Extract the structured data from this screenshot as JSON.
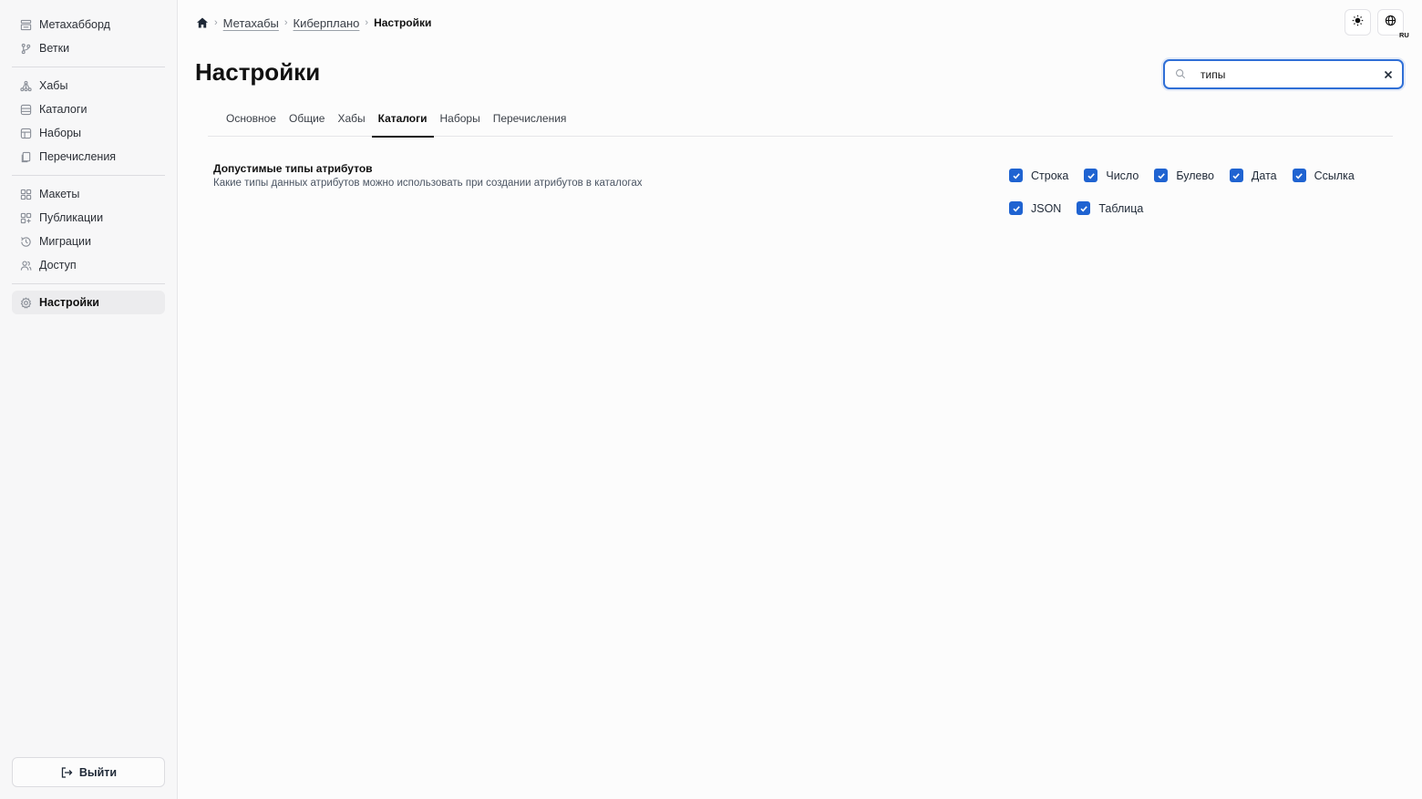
{
  "sidebar": {
    "groups": [
      [
        {
          "label": "Метахабборд",
          "icon": "dashboard-icon"
        },
        {
          "label": "Ветки",
          "icon": "branch-icon"
        }
      ],
      [
        {
          "label": "Хабы",
          "icon": "hub-icon"
        },
        {
          "label": "Каталоги",
          "icon": "database-icon"
        },
        {
          "label": "Наборы",
          "icon": "set-icon"
        },
        {
          "label": "Перечисления",
          "icon": "enum-icon"
        }
      ],
      [
        {
          "label": "Макеты",
          "icon": "layout-icon"
        },
        {
          "label": "Публикации",
          "icon": "publish-icon"
        },
        {
          "label": "Миграции",
          "icon": "history-icon"
        },
        {
          "label": "Доступ",
          "icon": "users-icon"
        }
      ],
      [
        {
          "label": "Настройки",
          "icon": "gear-icon",
          "active": true
        }
      ]
    ],
    "logout_label": "Выйти"
  },
  "breadcrumb": {
    "items": [
      "Метахабы",
      "Киберплано"
    ],
    "current": "Настройки"
  },
  "header": {
    "title": "Настройки",
    "lang": "RU"
  },
  "search": {
    "value": "типы",
    "placeholder": ""
  },
  "tabs": [
    {
      "label": "Основное"
    },
    {
      "label": "Общие"
    },
    {
      "label": "Хабы"
    },
    {
      "label": "Каталоги",
      "active": true
    },
    {
      "label": "Наборы"
    },
    {
      "label": "Перечисления"
    }
  ],
  "setting": {
    "title": "Допустимые типы атрибутов",
    "description": "Какие типы данных атрибутов можно использовать при создании атрибутов в каталогах",
    "options_rows": [
      [
        {
          "label": "Строка",
          "checked": true
        },
        {
          "label": "Число",
          "checked": true
        },
        {
          "label": "Булево",
          "checked": true
        },
        {
          "label": "Дата",
          "checked": true
        },
        {
          "label": "Ссылка",
          "checked": true
        }
      ],
      [
        {
          "label": "JSON",
          "checked": true
        },
        {
          "label": "Таблица",
          "checked": true
        }
      ]
    ]
  },
  "colors": {
    "accent": "#1f63d1",
    "focus_border": "#2f6fd6"
  }
}
